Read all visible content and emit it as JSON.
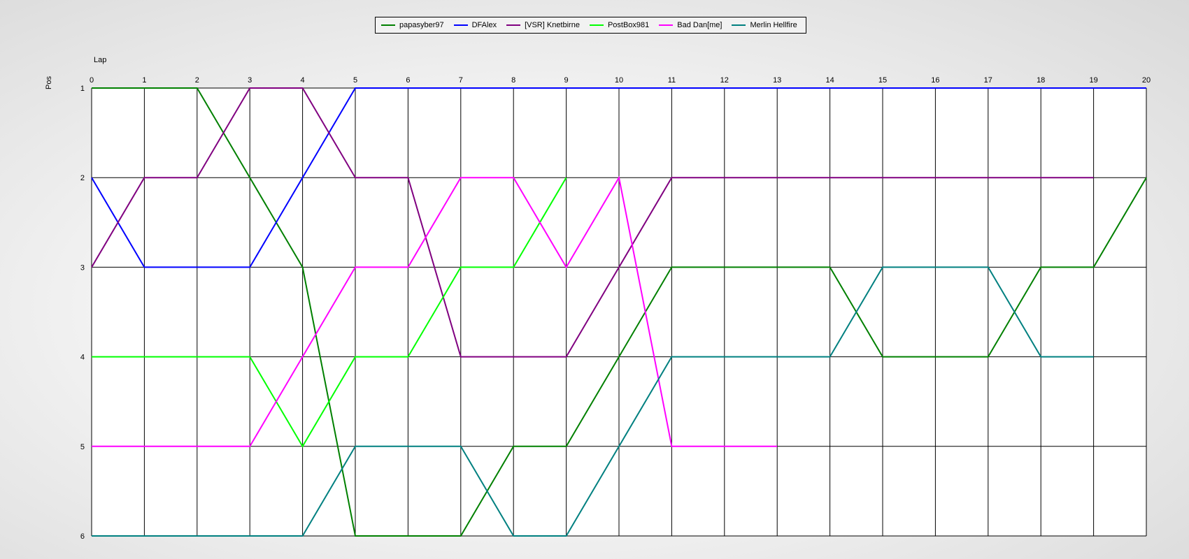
{
  "chart_data": {
    "type": "line",
    "xlabel": "Lap",
    "ylabel": "Pos",
    "xlim": [
      0,
      20
    ],
    "ylim": [
      1,
      6
    ],
    "y_inverted": true,
    "x_ticks": [
      0,
      1,
      2,
      3,
      4,
      5,
      6,
      7,
      8,
      9,
      10,
      11,
      12,
      13,
      14,
      15,
      16,
      17,
      18,
      19,
      20
    ],
    "y_ticks": [
      1,
      2,
      3,
      4,
      5,
      6
    ],
    "grid": true,
    "legend_position": "top-center",
    "series": [
      {
        "name": "papasyber97",
        "color": "#008000",
        "x": [
          0,
          1,
          2,
          3,
          4,
          5,
          6,
          7,
          8,
          9,
          10,
          11,
          12,
          13,
          14,
          15,
          16,
          17,
          18,
          19,
          20
        ],
        "y": [
          1,
          1,
          1,
          2,
          3,
          6,
          6,
          6,
          5,
          5,
          4,
          3,
          3,
          3,
          3,
          4,
          4,
          4,
          3,
          3,
          2
        ]
      },
      {
        "name": "DFAlex",
        "color": "#0000ff",
        "x": [
          0,
          1,
          2,
          3,
          4,
          5,
          6,
          7,
          8,
          9,
          10,
          11,
          12,
          13,
          14,
          15,
          16,
          17,
          18,
          19,
          20
        ],
        "y": [
          2,
          3,
          3,
          3,
          2,
          1,
          1,
          1,
          1,
          1,
          1,
          1,
          1,
          1,
          1,
          1,
          1,
          1,
          1,
          1,
          1
        ]
      },
      {
        "name": "[VSR] Knetbirne",
        "color": "#800080",
        "x": [
          0,
          1,
          2,
          3,
          4,
          5,
          6,
          7,
          8,
          9,
          10,
          11,
          12,
          13,
          14,
          15,
          16,
          17,
          18,
          19
        ],
        "y": [
          3,
          2,
          2,
          1,
          1,
          2,
          2,
          4,
          4,
          4,
          3,
          2,
          2,
          2,
          2,
          2,
          2,
          2,
          2,
          2
        ]
      },
      {
        "name": "PostBox981",
        "color": "#00ff00",
        "x": [
          0,
          1,
          2,
          3,
          4,
          5,
          6,
          7,
          8,
          9
        ],
        "y": [
          4,
          4,
          4,
          4,
          5,
          4,
          4,
          3,
          3,
          2
        ]
      },
      {
        "name": "Bad Dan[me]",
        "color": "#ff00ff",
        "x": [
          0,
          1,
          2,
          3,
          4,
          5,
          6,
          7,
          8,
          9,
          10,
          11,
          12,
          13
        ],
        "y": [
          5,
          5,
          5,
          5,
          4,
          3,
          3,
          2,
          2,
          3,
          2,
          5,
          5,
          5
        ]
      },
      {
        "name": "Merlin Hellfire",
        "color": "#008080",
        "x": [
          0,
          1,
          2,
          3,
          4,
          5,
          6,
          7,
          8,
          9,
          10,
          11,
          12,
          13,
          14,
          15,
          16,
          17,
          18,
          19
        ],
        "y": [
          6,
          6,
          6,
          6,
          6,
          5,
          5,
          5,
          6,
          6,
          5,
          4,
          4,
          4,
          4,
          3,
          3,
          3,
          4,
          4
        ]
      }
    ]
  }
}
